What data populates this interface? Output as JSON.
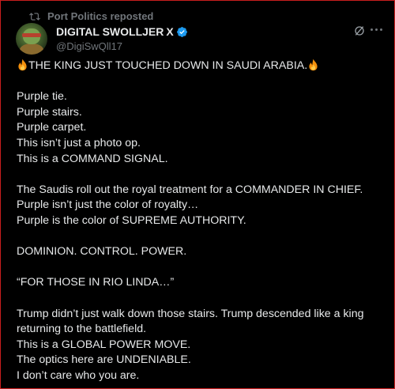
{
  "repost": {
    "text": "Port Politics reposted"
  },
  "author": {
    "display_name": "DIGITAL SWOLLJER",
    "name_suffix": "X",
    "handle": "@DigiSwQll17"
  },
  "icons": {
    "repost": "repost-icon",
    "verified": "verified-badge-icon",
    "grok": "grok-icon",
    "more": "more-options-icon",
    "fire": "fire-emoji-icon"
  },
  "colors": {
    "background": "#000000",
    "text": "#e7e9ea",
    "muted": "#71767b",
    "verified": "#1d9bf0",
    "frame": "#c81e1e"
  },
  "post": {
    "headline": "THE KING JUST TOUCHED DOWN IN SAUDI ARABIA.",
    "lines": [
      "Purple tie.",
      "Purple stairs.",
      "Purple carpet.",
      "This isn’t just a photo op.",
      "This is a COMMAND SIGNAL.",
      "",
      "The Saudis roll out the royal treatment for a COMMANDER IN CHIEF.",
      "Purple isn’t just the color of royalty…",
      "Purple is the color of SUPREME AUTHORITY.",
      "",
      "DOMINION. CONTROL. POWER.",
      "",
      "“FOR THOSE IN RIO LINDA…”",
      "",
      "Trump didn’t just walk down those stairs. Trump descended like a king",
      "returning to the battlefield.",
      "This is a GLOBAL POWER MOVE.",
      "The optics here are UNDENIABLE.",
      "I don’t care who you are."
    ]
  }
}
